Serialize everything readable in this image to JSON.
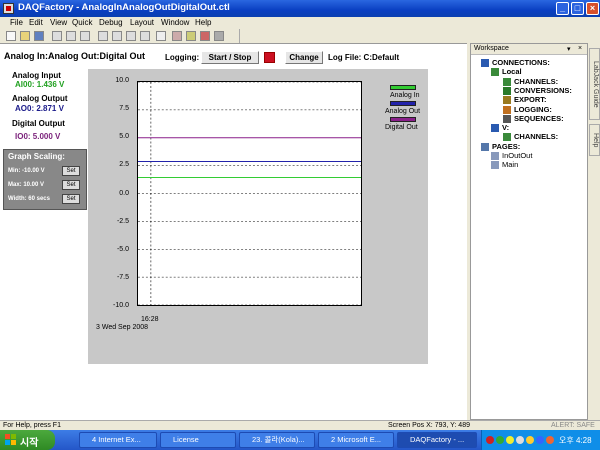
{
  "window": {
    "title": "DAQFactory - AnalogInAnalogOutDigitalOut.ctl",
    "controls": [
      "_",
      "□",
      "×"
    ]
  },
  "menu": [
    "File",
    "Edit",
    "View",
    "Quick",
    "Debug",
    "Layout",
    "Window",
    "Help"
  ],
  "page": {
    "title": "Analog In:Analog Out:Digital Out",
    "logging_label": "Logging:",
    "start_stop_label": "Start / Stop",
    "change_label": "Change",
    "log_file_label": "Log File: C:Default",
    "analog_input_label": "Analog Input",
    "analog_input_value": "AI00: 1.436 V",
    "analog_output_label": "Analog Output",
    "analog_output_value": "AO0: 2.871 V",
    "digital_output_label": "Digital Output",
    "digital_output_value": "IO0: 5.000 V",
    "scaling": {
      "title": "Graph Scaling:",
      "rows": [
        {
          "label": "Min: -10.00 V",
          "button": "Set"
        },
        {
          "label": "Max: 10.00 V",
          "button": "Set"
        },
        {
          "label": "Width: 60 secs",
          "button": "Set"
        }
      ]
    }
  },
  "chart_data": {
    "type": "line",
    "ylim": [
      -10,
      10
    ],
    "y_ticks": [
      "10.0",
      "7.5",
      "5.0",
      "2.5",
      "0.0",
      "-2.5",
      "-5.0",
      "-7.5",
      "-10.0"
    ],
    "x_tick_label": "16:28",
    "x_date_label": "3 Wed Sep 2008",
    "grid": true,
    "legend_position": "top-right",
    "series": [
      {
        "name": "Analog In",
        "color": "#33cc33",
        "value": 1.436
      },
      {
        "name": "Analog Out",
        "color": "#2222aa",
        "value": 2.871
      },
      {
        "name": "Digital Out",
        "color": "#8a1f8a",
        "value": 5.0
      }
    ]
  },
  "workspace": {
    "title": "Workspace",
    "header_controls": [
      "▾",
      "×"
    ],
    "tree": [
      {
        "label": "CONNECTIONS:",
        "level": 0,
        "icon": "connections-icon"
      },
      {
        "label": "Local",
        "level": 1,
        "icon": "local-icon"
      },
      {
        "label": "CHANNELS:",
        "level": 2,
        "icon": "channels-icon"
      },
      {
        "label": "CONVERSIONS:",
        "level": 2,
        "icon": "conversions-icon"
      },
      {
        "label": "EXPORT:",
        "level": 2,
        "icon": "export-icon"
      },
      {
        "label": "LOGGING:",
        "level": 2,
        "icon": "logging-icon"
      },
      {
        "label": "SEQUENCES:",
        "level": 2,
        "icon": "sequences-icon"
      },
      {
        "label": "V:",
        "level": 1,
        "icon": "v-icon"
      },
      {
        "label": "CHANNELS:",
        "level": 2,
        "icon": "channels-icon"
      },
      {
        "label": "PAGES:",
        "level": 0,
        "icon": "pages-icon"
      },
      {
        "label": "InOutOut",
        "level": 1,
        "icon": "page-icon"
      },
      {
        "label": "Main",
        "level": 1,
        "icon": "page-icon"
      }
    ],
    "side_tabs": [
      "LabJack Guide",
      "Help"
    ]
  },
  "status": {
    "left": "For Help, press F1",
    "screen_pos": "Screen Pos X: 793, Y: 489",
    "alert": "ALERT: SAFE"
  },
  "taskbar": {
    "start_label": "시작",
    "tasks": [
      "4 Internet Ex...",
      "License",
      "23. 콜라(Kola)...",
      "2 Microsoft E...",
      "DAQFactory - ..."
    ],
    "clock": "오후 4:28"
  }
}
